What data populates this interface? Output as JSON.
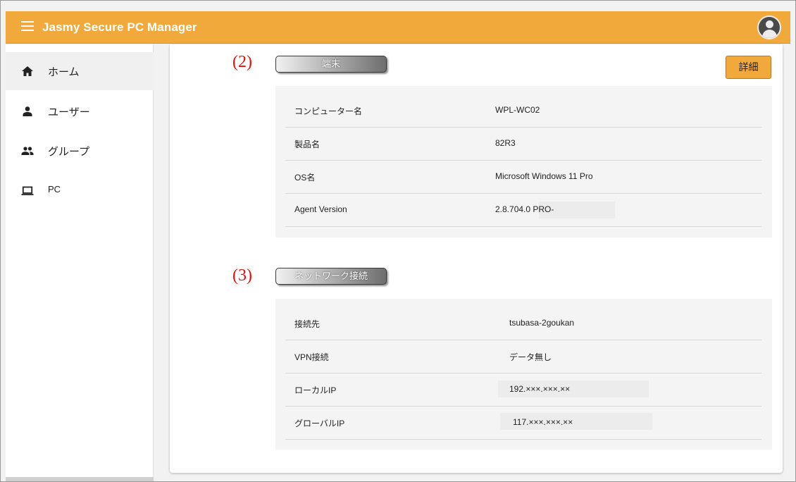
{
  "app": {
    "title": "Jasmy Secure PC Manager"
  },
  "sidebar": {
    "items": [
      {
        "label": "ホーム",
        "icon": "home-icon"
      },
      {
        "label": "ユーザー",
        "icon": "person-icon"
      },
      {
        "label": "グループ",
        "icon": "group-icon"
      },
      {
        "label": "PC",
        "icon": "laptop-icon"
      }
    ]
  },
  "terminal": {
    "number": "(2)",
    "title": "端末",
    "detail_button": "詳細",
    "rows": [
      {
        "key": "コンピューター名",
        "value": "WPL-WC02"
      },
      {
        "key": "製品名",
        "value": "82R3"
      },
      {
        "key": "OS名",
        "value": "Microsoft Windows 11 Pro"
      },
      {
        "key": "Agent Version",
        "value": "2.8.704.0 PRO-"
      }
    ]
  },
  "network": {
    "number": "(3)",
    "title": "ネットワーク接続",
    "rows": [
      {
        "key": "接続先",
        "value": "tsubasa-2goukan"
      },
      {
        "key": "VPN接続",
        "value": "データ無し"
      },
      {
        "key": "ローカルIP",
        "value": "192.×××.×××.××"
      },
      {
        "key": "グローバルIP",
        "value": "117.×××.×××.××"
      }
    ]
  },
  "colors": {
    "accent": "#f2a93b",
    "annotation": "#e01010"
  }
}
